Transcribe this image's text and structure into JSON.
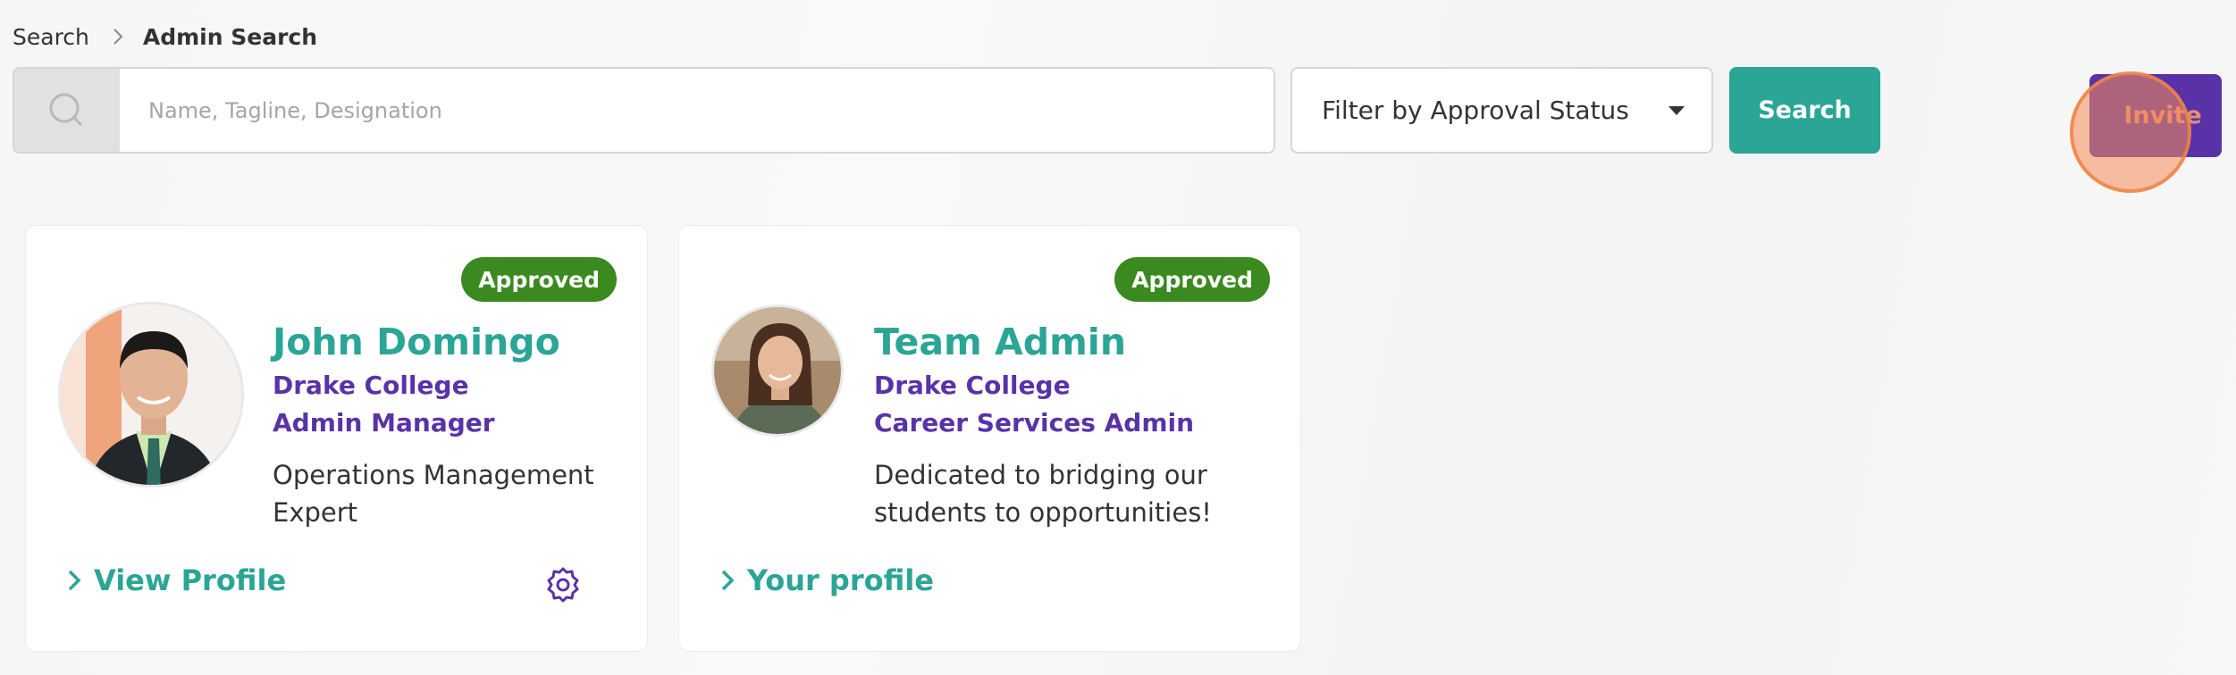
{
  "breadcrumb": {
    "parent": "Search",
    "current": "Admin Search"
  },
  "search": {
    "placeholder": "Name, Tagline, Designation",
    "value": ""
  },
  "filter": {
    "label": "Filter by Approval Status"
  },
  "buttons": {
    "search": "Search",
    "invite": "Invite"
  },
  "cards": [
    {
      "status": "Approved",
      "name": "John Domingo",
      "org": "Drake College",
      "role": "Admin Manager",
      "tagline": "Operations Management Expert",
      "link": "View Profile"
    },
    {
      "status": "Approved",
      "name": "Team Admin",
      "org": "Drake College",
      "role": "Career Services Admin",
      "tagline": "Dedicated to bridging our students to opportunities!",
      "link": "Your profile"
    }
  ],
  "icons": [
    "search-icon",
    "chevron-right-icon",
    "caret-down-icon",
    "gear-icon"
  ],
  "colors": {
    "teal": "#2aa596",
    "purple": "#5a32a8",
    "approved_green": "#3a8a1f"
  }
}
